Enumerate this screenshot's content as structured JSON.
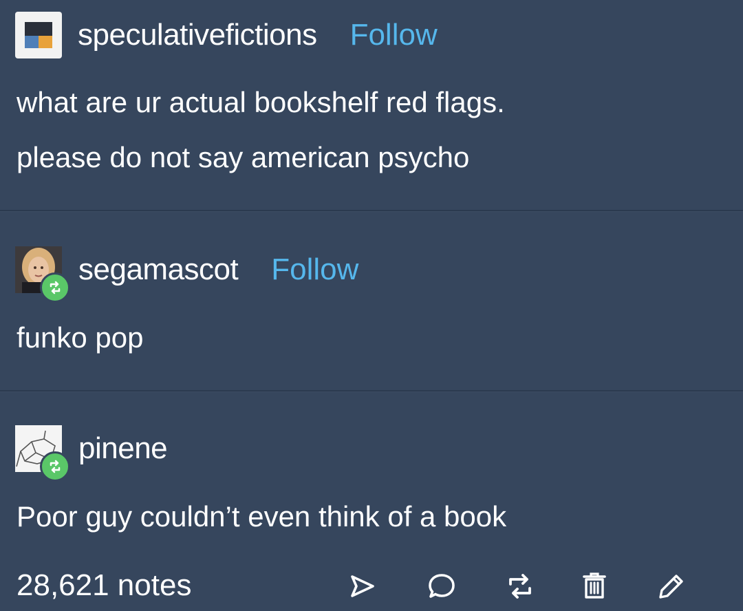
{
  "post": {
    "original": {
      "username": "speculativefictions",
      "follow_label": "Follow",
      "lines": [
        "what are ur actual bookshelf red flags.",
        "please do not say american psycho"
      ]
    },
    "reblogs": [
      {
        "username": "segamascot",
        "follow_label": "Follow",
        "text": "funko pop"
      },
      {
        "username": "pinene",
        "text": "Poor guy couldn’t even think of a book"
      }
    ],
    "footer": {
      "notes": "28,621 notes",
      "actions": [
        "share-icon",
        "reply-icon",
        "reblog-icon",
        "delete-icon",
        "edit-icon"
      ]
    }
  },
  "colors": {
    "background": "#36465d",
    "follow": "#56b7ec",
    "reblog_badge": "#5ac768",
    "text": "#ffffff"
  }
}
